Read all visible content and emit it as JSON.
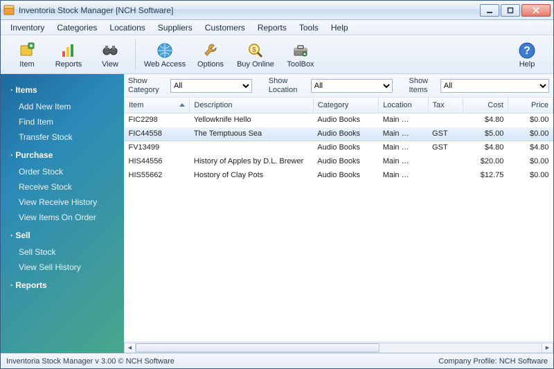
{
  "window": {
    "title": "Inventoria Stock Manager [NCH Software]"
  },
  "menu": [
    "Inventory",
    "Categories",
    "Locations",
    "Suppliers",
    "Customers",
    "Reports",
    "Tools",
    "Help"
  ],
  "toolbar": {
    "item": "Item",
    "reports": "Reports",
    "view": "View",
    "web_access": "Web Access",
    "options": "Options",
    "buy_online": "Buy Online",
    "toolbox": "ToolBox",
    "help": "Help"
  },
  "sidebar": {
    "groups": [
      {
        "title": "Items",
        "links": [
          "Add New Item",
          "Find Item",
          "Transfer Stock"
        ]
      },
      {
        "title": "Purchase",
        "links": [
          "Order Stock",
          "Receive Stock",
          "View Receive History",
          "View Items On Order"
        ]
      },
      {
        "title": "Sell",
        "links": [
          "Sell Stock",
          "View Sell History"
        ]
      },
      {
        "title": "Reports",
        "links": []
      }
    ]
  },
  "filters": {
    "show_category_label": "Show Category",
    "show_category_value": "All",
    "show_location_label": "Show Location",
    "show_location_value": "All",
    "show_items_label": "Show Items",
    "show_items_value": "All"
  },
  "columns": [
    "Item",
    "Description",
    "Category",
    "Location",
    "Tax",
    "Cost",
    "Price"
  ],
  "rows": [
    {
      "item": "FIC2298",
      "description": "Yellowknife Hello",
      "category": "Audio Books",
      "location": "Main …",
      "tax": "",
      "cost": "$4.80",
      "price": "$0.00",
      "selected": false
    },
    {
      "item": "FIC44558",
      "description": "The Temptuous Sea",
      "category": "Audio Books",
      "location": "Main …",
      "tax": "GST",
      "cost": "$5.00",
      "price": "$0.00",
      "selected": true
    },
    {
      "item": "FV13499",
      "description": "",
      "category": "Audio Books",
      "location": "Main …",
      "tax": "GST",
      "cost": "$4.80",
      "price": "$4.80",
      "selected": false
    },
    {
      "item": "HIS44556",
      "description": "History of Apples by D.L. Brewer",
      "category": "Audio Books",
      "location": "Main …",
      "tax": "",
      "cost": "$20.00",
      "price": "$0.00",
      "selected": false
    },
    {
      "item": "HIS55662",
      "description": "Hostory of Clay Pots",
      "category": "Audio Books",
      "location": "Main …",
      "tax": "",
      "cost": "$12.75",
      "price": "$0.00",
      "selected": false
    }
  ],
  "status": {
    "left": "Inventoria Stock Manager v 3.00 © NCH Software",
    "right": "Company Profile: NCH Software"
  }
}
